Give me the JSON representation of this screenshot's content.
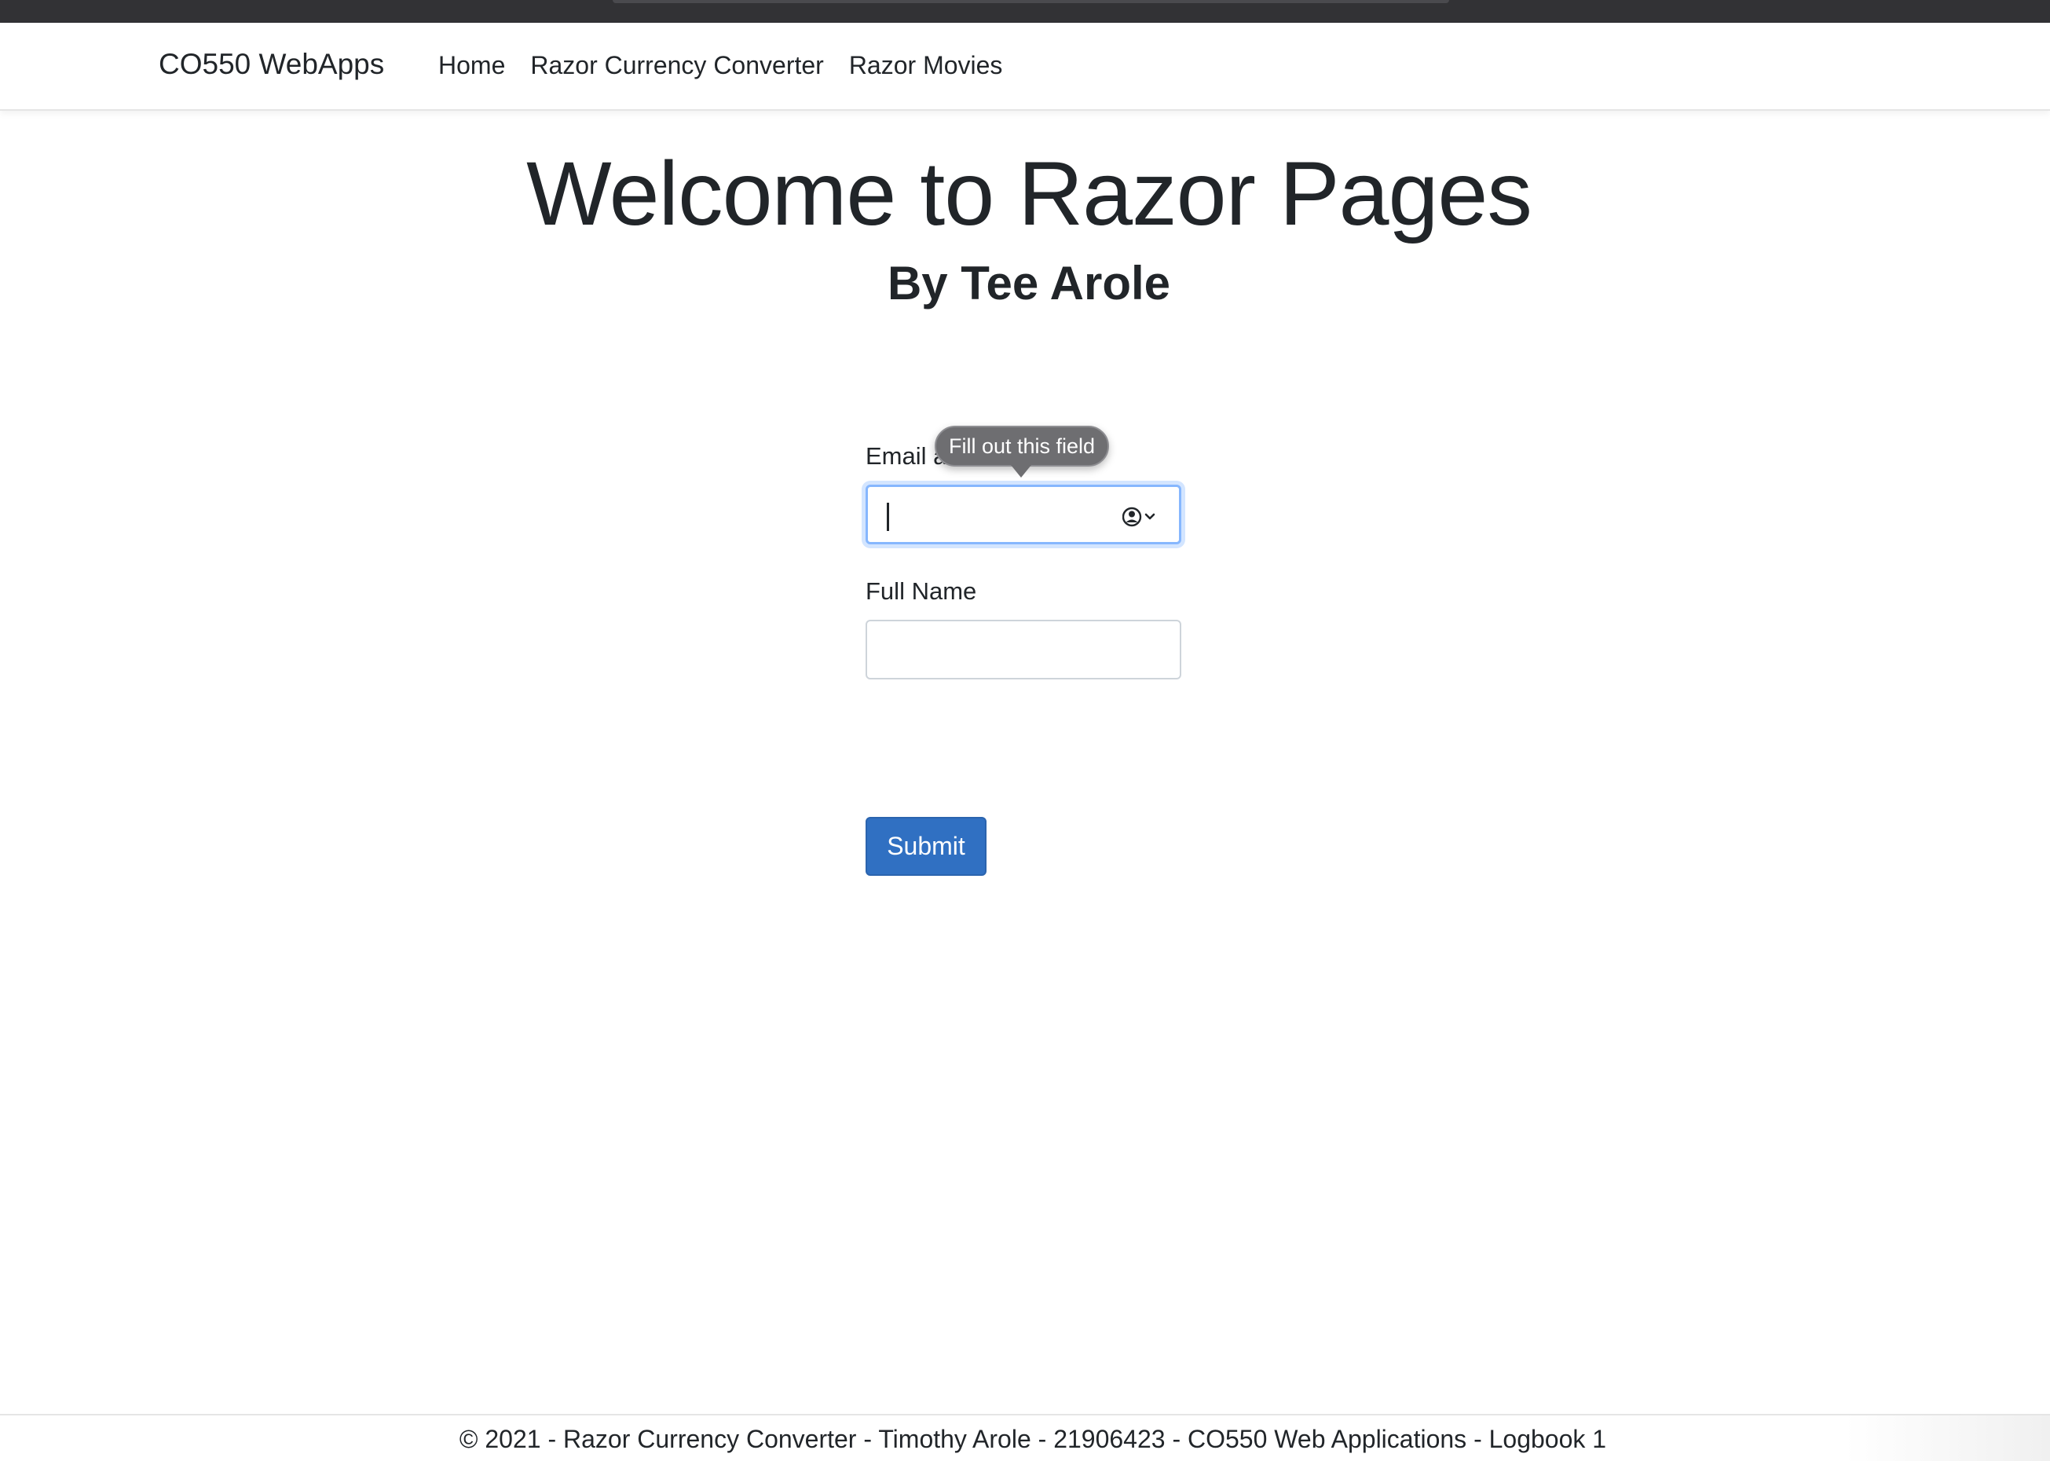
{
  "navbar": {
    "brand": "CO550 WebApps",
    "links": [
      "Home",
      "Razor Currency Converter",
      "Razor Movies"
    ]
  },
  "page": {
    "title": "Welcome to Razor Pages",
    "subtitle": "By Tee Arole"
  },
  "form": {
    "email_label": "Email a",
    "email_value": "",
    "fullname_label": "Full Name",
    "fullname_value": "",
    "submit_label": "Submit",
    "validation_tooltip": "Fill out this field"
  },
  "footer": {
    "text": "© 2021 - Razor Currency Converter - Timothy Arole - 21906423 - CO550 Web Applications - Logbook 1"
  },
  "colors": {
    "primary_button": "#3070c2",
    "focus_ring": "#86b7fe",
    "tooltip_bg": "#6e6e71",
    "browser_chrome": "#323235"
  },
  "icons": {
    "autofill": "contact-card-autofill-icon"
  }
}
